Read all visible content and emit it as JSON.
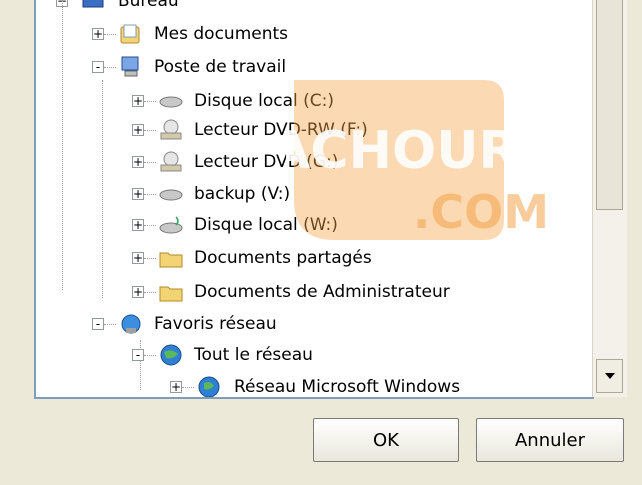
{
  "tree": {
    "top_partial_label": "Bureau",
    "items": [
      {
        "label": "Mes documents",
        "expand": "+"
      },
      {
        "label": "Poste de travail",
        "expand": "-"
      },
      {
        "label": "Disque local (C:)",
        "expand": "+"
      },
      {
        "label": "Lecteur DVD-RW (F:)",
        "expand": "+"
      },
      {
        "label": "Lecteur DVD (G:)",
        "expand": "+"
      },
      {
        "label": "backup (V:)",
        "expand": "+"
      },
      {
        "label": "Disque local (W:)",
        "expand": "+"
      },
      {
        "label": "Documents partagés",
        "expand": "+"
      },
      {
        "label": "Documents de Administrateur",
        "expand": "+"
      },
      {
        "label": "Favoris réseau",
        "expand": "-"
      },
      {
        "label": "Tout le réseau",
        "expand": "-"
      },
      {
        "label": "Réseau Microsoft Windows",
        "expand": "+"
      }
    ]
  },
  "watermark": {
    "line1": "ACHOURI",
    "line2": ".COM"
  },
  "buttons": {
    "ok": "OK",
    "cancel": "Annuler"
  },
  "colors": {
    "accent": "#f5a44a",
    "border": "#7f9db9",
    "dialog_bg": "#ece9d8"
  }
}
